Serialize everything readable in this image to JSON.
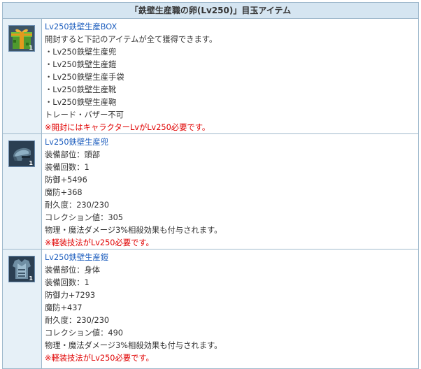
{
  "header": {
    "title": "「鉄壁生産職の卵(Lv250)」目玉アイテム"
  },
  "items": [
    {
      "icon": "gift-box-icon",
      "quantity": "1",
      "name": "Lv250鉄壁生産BOX",
      "lines": [
        "開封すると下記のアイテムが全て獲得できます。",
        "・Lv250鉄壁生産兜",
        "・Lv250鉄壁生産鎧",
        "・Lv250鉄壁生産手袋",
        "・Lv250鉄壁生産靴",
        "・Lv250鉄壁生産鞄",
        "トレード・バザー不可"
      ],
      "warning": "※開封にはキャラクターLvがLv250必要です。"
    },
    {
      "icon": "helmet-icon",
      "quantity": "1",
      "name": "Lv250鉄壁生産兜",
      "lines": [
        "装備部位：頭部",
        "装備回数：1",
        "防御+5496",
        "魔防+368",
        "耐久度：230/230",
        "コレクション値：305",
        "物理・魔法ダメージ3%相殺効果も付与されます。"
      ],
      "warning": "※軽装技法がLv250必要です。"
    },
    {
      "icon": "armor-icon",
      "quantity": "1",
      "name": "Lv250鉄壁生産鎧",
      "lines": [
        "装備部位：身体",
        "装備回数：1",
        "防御力+7293",
        "魔防+437",
        "耐久度：230/230",
        "コレクション値：490",
        "物理・魔法ダメージ3%相殺効果も付与されます。"
      ],
      "warning": "※軽装技法がLv250必要です。"
    }
  ]
}
